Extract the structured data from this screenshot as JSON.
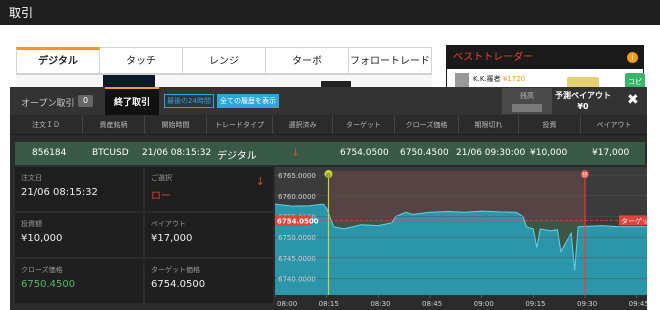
{
  "page": {
    "title": "取引"
  },
  "tabs": [
    {
      "label": "デジタル",
      "active": true
    },
    {
      "label": "タッチ",
      "active": false
    },
    {
      "label": "レンジ",
      "active": false
    },
    {
      "label": "ターボ",
      "active": false
    },
    {
      "label": "フォロートレード",
      "active": false
    }
  ],
  "best_traders": {
    "title": "ベストトレーダー",
    "trader_name": "K.K.羅者",
    "trader_amount": "¥1720",
    "copy_label": "コピー"
  },
  "panel": {
    "open_tab": "オープン取引",
    "open_count": "0",
    "closed_tab": "終了取引",
    "filter_24h": "最後の24時間",
    "filter_all": "全ての履歴を表示",
    "balance_label": "残高",
    "payout_label": "予測ペイアウト",
    "payout_value": "¥0"
  },
  "columns": [
    "注文ＩＤ",
    "資産銘柄",
    "開始時間",
    "トレードタイプ",
    "選択済み",
    "ターゲット",
    "クローズ価格",
    "期限切れ",
    "投資",
    "ペイアウト"
  ],
  "trade_row": {
    "id": "856184",
    "asset": "BTCUSD",
    "open_time": "21/06 08:15:32",
    "type": "デジタル",
    "direction": "↓",
    "target": "6754.0500",
    "close_price": "6750.4500",
    "expiry": "21/06 09:30:00",
    "investment": "¥10,000",
    "payout": "¥17,000"
  },
  "details": {
    "order_date_label": "注文日",
    "order_date": "21/06 08:15:32",
    "choice_label": "ご選択",
    "choice_value": "ロー",
    "invest_label": "投資額",
    "invest_value": "¥10,000",
    "payout_label": "ペイアウト",
    "payout_value": "¥17,000",
    "close_label": "クローズ価格",
    "close_value": "6750.4500",
    "target_label": "ターゲット価格",
    "target_value": "6754.0500"
  },
  "colors": {
    "accent": "#f29a1c",
    "blue": "#2aa6dd",
    "down": "#e0433b",
    "row_green": "#395a47",
    "chart_fill": "#2a9ab0"
  },
  "chart_data": {
    "type": "area",
    "y_ticks": [
      "6765.0000",
      "6760.0000",
      "6755.0000",
      "6750.0000",
      "6745.0000",
      "6740.0000"
    ],
    "ylim": [
      6736,
      6766
    ],
    "x_ticks": [
      "08:00",
      "08:15",
      "08:30",
      "08:45",
      "09:00",
      "09:15",
      "09:30",
      "09:45"
    ],
    "xlim": [
      0,
      108
    ],
    "x": [
      0,
      5,
      10,
      14,
      15,
      17,
      20,
      25,
      30,
      34,
      35,
      38,
      40,
      45,
      50,
      55,
      60,
      65,
      70,
      72,
      73,
      75,
      76,
      77,
      80,
      82,
      83,
      86,
      87,
      88,
      90,
      95,
      100,
      108
    ],
    "y": [
      6758.0,
      6757.5,
      6757.6,
      6758.0,
      6757.0,
      6752.5,
      6752.0,
      6753.0,
      6752.8,
      6753.5,
      6755.0,
      6756.0,
      6755.5,
      6756.0,
      6756.2,
      6756.0,
      6756.3,
      6756.1,
      6756.0,
      6755.0,
      6752.5,
      6752.0,
      6747.5,
      6752.0,
      6751.5,
      6751.8,
      6746.5,
      6751.0,
      6742.0,
      6752.5,
      6752.6,
      6752.8,
      6752.5,
      6752.5
    ],
    "target_value": 6754.05,
    "target_label": "ターゲット",
    "start_time": 15.53,
    "end_time": 90,
    "marker_start": "◎",
    "marker_end": "終"
  }
}
